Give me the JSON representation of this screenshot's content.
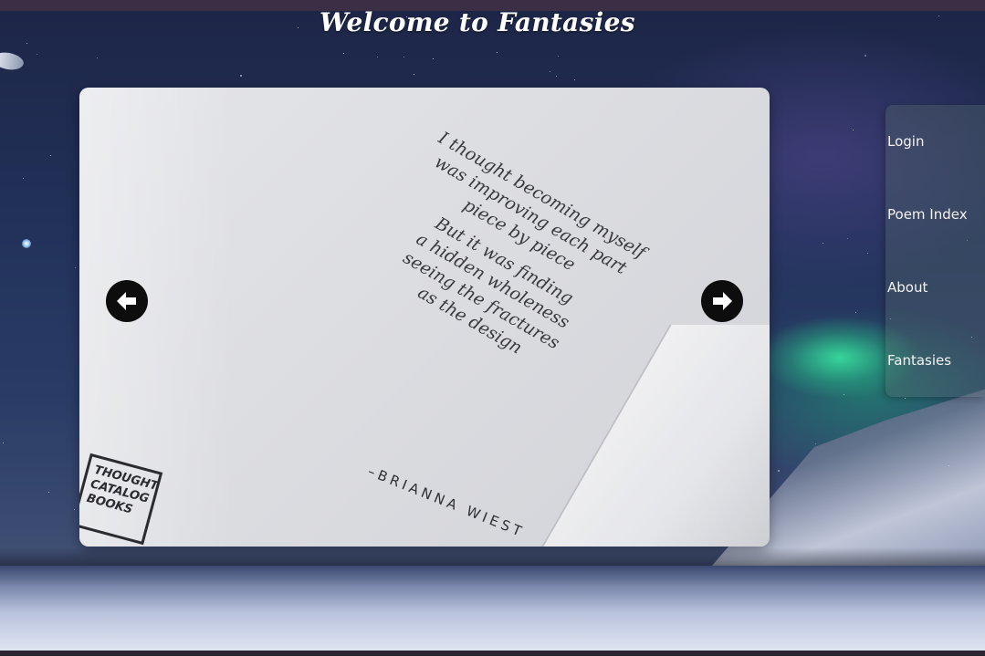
{
  "header": {
    "title": "Welcome to Fantasies"
  },
  "slider": {
    "poem": {
      "stanza1": [
        "I thought becoming myself",
        "was improving each part",
        "piece by piece"
      ],
      "stanza2": [
        "But it was finding",
        "a hidden wholeness",
        "seeing the fractures",
        "as the design"
      ],
      "author": "–BRIANNA WIEST"
    },
    "publisher_logo": [
      "THOUGHT",
      "CATALOG",
      "BOOKS"
    ],
    "prev_icon": "arrow-left-circle-icon",
    "next_icon": "arrow-right-circle-icon"
  },
  "nav": {
    "items": [
      {
        "label": "Login"
      },
      {
        "label": "Poem Index"
      },
      {
        "label": "About"
      },
      {
        "label": "Fantasies"
      }
    ]
  },
  "colors": {
    "arrow_bg": "#0d0d0d",
    "title_text": "#ffffff",
    "nav_text": "#f3f3f3"
  }
}
